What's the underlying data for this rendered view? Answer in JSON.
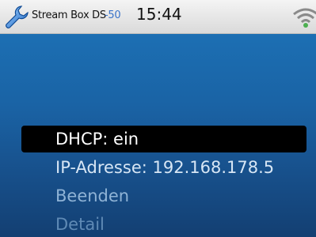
{
  "status_bar": {
    "device_name": "Stream Box DS",
    "signal_value": "-50",
    "time": "15:44",
    "left_icon": "wrench-icon",
    "right_icon": "wifi-icon"
  },
  "menu": {
    "items": [
      {
        "label": "DHCP: ein",
        "selected": true
      },
      {
        "label": "IP-Adresse: 192.168.178.5",
        "selected": false
      },
      {
        "label": "Beenden",
        "selected": false
      },
      {
        "label": "Detail",
        "selected": false
      }
    ]
  },
  "colors": {
    "screen_background": "#1a63a5",
    "selection_background": "#000000",
    "signal_value": "#3a73c9",
    "wifi_indicator": "#4caf50"
  }
}
